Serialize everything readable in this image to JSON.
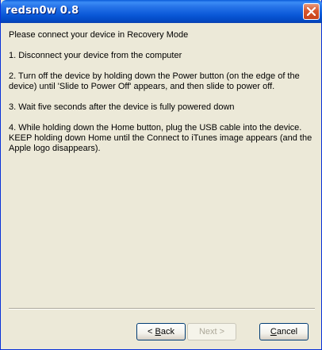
{
  "window": {
    "title": "redsn0w 0.8"
  },
  "content": {
    "heading": "Please connect your device in Recovery Mode",
    "steps": [
      "1. Disconnect your device from the computer",
      "2. Turn off the device by holding down the Power button (on the edge of the device) until 'Slide to Power Off' appears, and then slide to power off.",
      "3. Wait five seconds after the device is fully powered down",
      "4. While holding down the Home button, plug the USB cable into the device. KEEP holding down Home until the Connect to iTunes image appears (and the Apple logo disappears)."
    ]
  },
  "buttons": {
    "back_prefix": "< ",
    "back_access": "B",
    "back_rest": "ack",
    "next": "Next >",
    "cancel_access": "C",
    "cancel_rest": "ancel"
  },
  "icons": {
    "close": "close-icon"
  },
  "colors": {
    "titlebar": "#0a58d8",
    "close_button": "#d8572e",
    "dialog_background": "#ece9d8",
    "disabled_text": "#aca899"
  }
}
